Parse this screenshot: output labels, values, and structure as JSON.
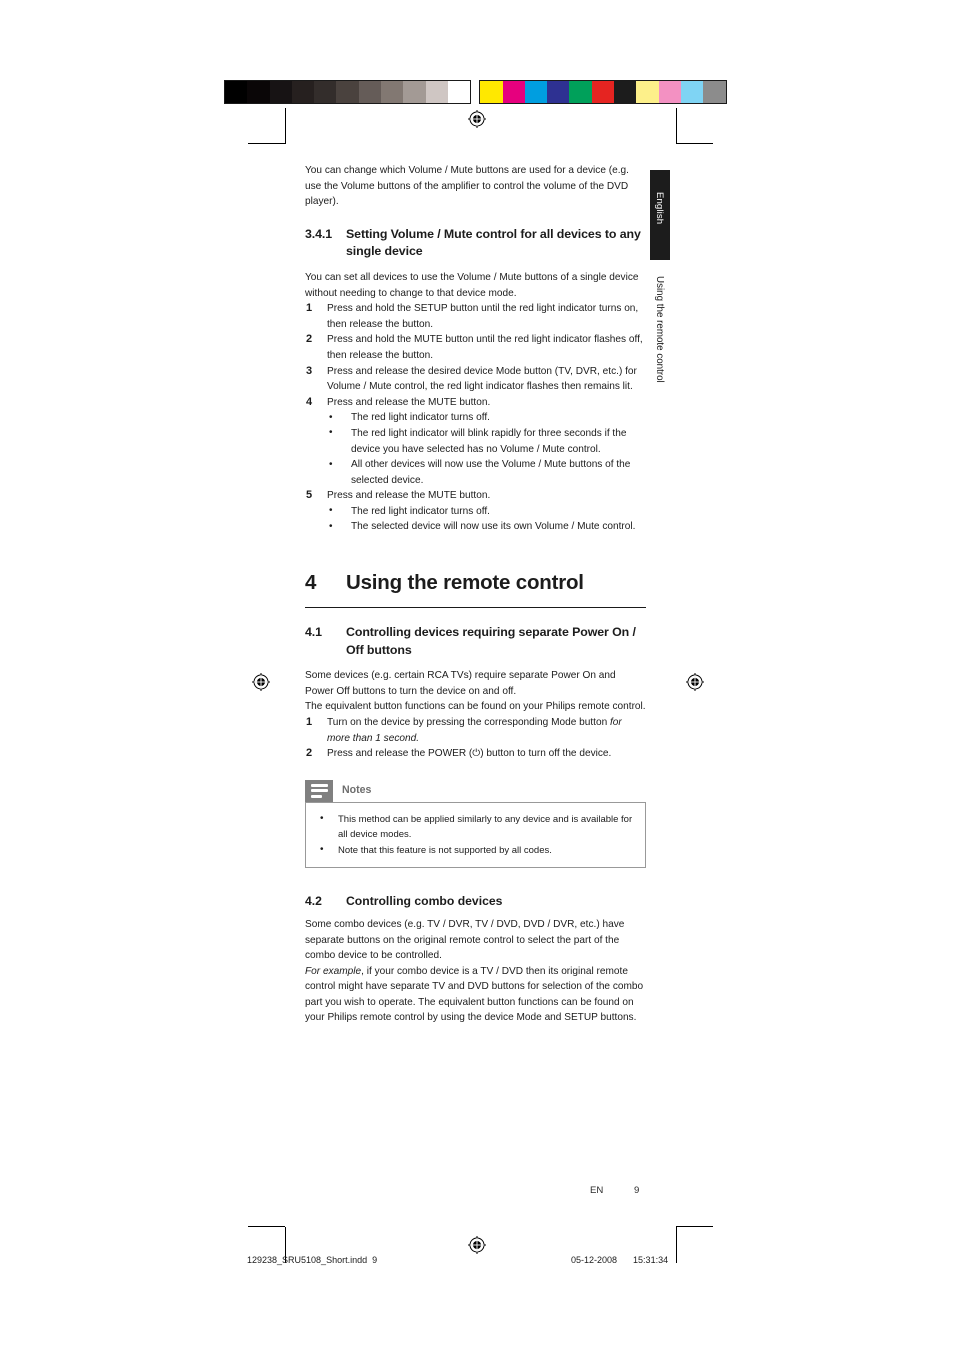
{
  "document": {
    "language_tab": "English",
    "side_caption": "Using the remote control",
    "page_marker": "EN",
    "page_number": "9",
    "print_footer": {
      "filename": "129238_SRU5108_Short.indd",
      "page": "9",
      "date": "05-12-2008",
      "time": "15:31:34"
    }
  },
  "colorbars": {
    "grayscale": [
      "#000000",
      "#0a0607",
      "#171314",
      "#26201f",
      "#332d2b",
      "#4a423e",
      "#655c58",
      "#827872",
      "#a39a95",
      "#cfc6c3",
      "#ffffff"
    ],
    "color": [
      "#ffe800",
      "#e6007e",
      "#009ee0",
      "#2e3192",
      "#00a05a",
      "#e52421",
      "#1c1c1c",
      "#fdf08a",
      "#f391c2",
      "#7fd4f4",
      "#8c8c8c"
    ]
  },
  "intro": {
    "paragraph": "You can change which Volume / Mute buttons are used for a device (e.g. use the Volume buttons of the amplifier to control the volume of the DVD player)."
  },
  "section_341": {
    "number": "3.4.1",
    "title": "Setting Volume / Mute control for all devices to any single device",
    "intro": "You can set all devices to use the Volume / Mute buttons of a single device without needing to change to that device mode.",
    "steps": [
      {
        "n": "1",
        "text": "Press and hold the SETUP button until the red light indicator turns on, then release the button.",
        "bullets": []
      },
      {
        "n": "2",
        "text": "Press and hold the MUTE button until the red light indicator flashes off, then release the button.",
        "bullets": []
      },
      {
        "n": "3",
        "text": "Press and release the desired device Mode button (TV, DVR, etc.) for Volume / Mute control, the red light indicator flashes then remains lit.",
        "bullets": []
      },
      {
        "n": "4",
        "text": "Press and release the MUTE button.",
        "bullets": [
          "The red light indicator turns off.",
          "The red light indicator will blink rapidly for three seconds if the device you have selected has no Volume / Mute control.",
          "All other devices will now use the Volume / Mute buttons of the selected device."
        ]
      },
      {
        "n": "5",
        "text": "Press and release the MUTE button.",
        "bullets": [
          "The red light indicator turns off.",
          "The selected device will now use its own Volume / Mute control."
        ]
      }
    ]
  },
  "chapter_4": {
    "number": "4",
    "title": "Using the remote control"
  },
  "section_41": {
    "number": "4.1",
    "title": "Controlling devices requiring separate Power On / Off buttons",
    "paragraph_1": "Some devices (e.g. certain RCA TVs) require separate Power On and Power Off buttons to turn the device on and off.",
    "paragraph_2": "The equivalent button functions can be found on your Philips remote control.",
    "steps": [
      {
        "n": "1",
        "text_before": "Turn on the device by pressing the corresponding Mode button ",
        "text_italic": "for more than 1 second.",
        "text_after": ""
      },
      {
        "n": "2",
        "text_before": "Press and release the POWER (",
        "text_symbol": "⏻",
        "text_after": ") button to turn off the device."
      }
    ]
  },
  "notes": {
    "title": "Notes",
    "items": [
      "This method can be applied similarly to any device and is available for all device modes.",
      "Note that this feature is not supported by all codes."
    ]
  },
  "section_42": {
    "number": "4.2",
    "title": "Controlling combo devices",
    "paragraph_1": "Some combo devices (e.g. TV / DVR, TV / DVD, DVD / DVR, etc.) have separate buttons on the original remote control to select the part of the combo device to be controlled.",
    "paragraph_2_italic": "For example",
    "paragraph_2_rest": ", if your combo device is a TV / DVD then its original remote control might have separate TV and DVD buttons for selection of the combo part you wish to operate. The equivalent button functions can be found on your Philips remote control by using the device Mode and SETUP buttons."
  }
}
